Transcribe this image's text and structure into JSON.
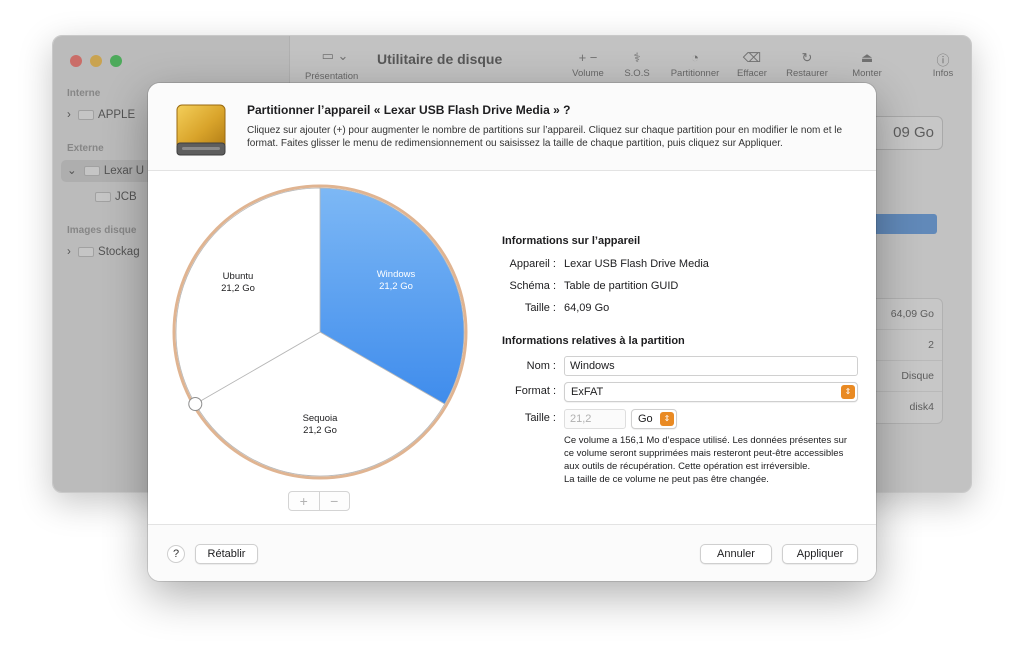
{
  "background_window": {
    "title": "Utilitaire de disque",
    "view_label": "Présentation",
    "toolbar": [
      "Volume",
      "S.O.S",
      "Partitionner",
      "Effacer",
      "Restaurer",
      "Monter",
      "Infos"
    ],
    "sidebar": {
      "section_internal": "Interne",
      "item_internal": "APPLE",
      "section_external": "Externe",
      "item_external": "Lexar U",
      "item_external_child": "JCB",
      "section_images": "Images disque",
      "item_images": "Stockag"
    },
    "capacity": "09 Go",
    "info_values": [
      "64,09 Go",
      "2",
      "Disque",
      "disk4"
    ]
  },
  "sheet": {
    "title": "Partitionner l’appareil « Lexar USB Flash Drive Media » ?",
    "description": "Cliquez sur ajouter (+) pour augmenter le nombre de partitions sur l’appareil. Cliquez sur chaque partition pour en modifier le nom et le format. Faites glisser le menu de redimensionnement ou saisissez la taille de chaque partition, puis cliquez sur Appliquer.",
    "partitions": [
      {
        "name": "Windows",
        "size": "21,2 Go",
        "selected": true
      },
      {
        "name": "Sequoia",
        "size": "21,2 Go",
        "selected": false
      },
      {
        "name": "Ubuntu",
        "size": "21,2 Go",
        "selected": false
      }
    ],
    "add_label": "+",
    "remove_label": "−",
    "device_info": {
      "heading": "Informations sur l’appareil",
      "device_label": "Appareil :",
      "device_value": "Lexar USB Flash Drive Media",
      "scheme_label": "Schéma :",
      "scheme_value": "Table de partition GUID",
      "size_label": "Taille :",
      "size_value": "64,09 Go"
    },
    "partition_info": {
      "heading": "Informations relatives à la partition",
      "name_label": "Nom :",
      "name_value": "Windows",
      "format_label": "Format :",
      "format_value": "ExFAT",
      "size_label": "Taille :",
      "size_value": "21,2",
      "unit_value": "Go"
    },
    "note": {
      "line1": "Ce volume a 156,1 Mo d’espace utilisé. Les données présentes sur ce volume seront supprimées mais resteront peut-être accessibles aux outils de récupération. Cette opération est irréversible.",
      "line2": "La taille de ce volume ne peut pas être changée."
    },
    "footer": {
      "help": "?",
      "revert": "Rétablir",
      "cancel": "Annuler",
      "apply": "Appliquer"
    }
  },
  "colors": {
    "selected_top": "#7db8f5",
    "selected_bottom": "#3f8cec",
    "ring": "#e0b491",
    "accent_orange": "#e98a23"
  }
}
